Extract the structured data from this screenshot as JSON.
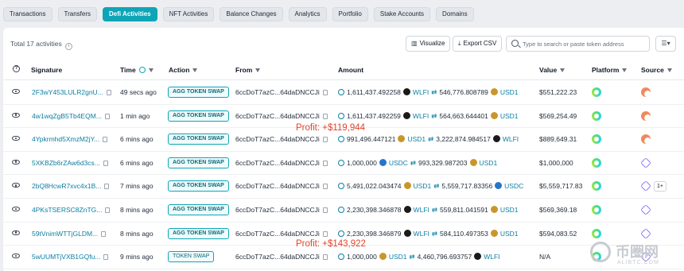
{
  "tabs": [
    {
      "label": "Transactions"
    },
    {
      "label": "Transfers"
    },
    {
      "label": "Defi Activities"
    },
    {
      "label": "NFT Activities"
    },
    {
      "label": "Balance Changes"
    },
    {
      "label": "Analytics"
    },
    {
      "label": "Portfolio"
    },
    {
      "label": "Stake Accounts"
    },
    {
      "label": "Domains"
    }
  ],
  "toolbar": {
    "total_label": "Total 17 activities",
    "visualize_label": "Visualize",
    "export_label": "Export CSV",
    "search_placeholder": "Type to search or paste token address"
  },
  "columns": {
    "signature": "Signature",
    "time": "Time",
    "action": "Action",
    "from": "From",
    "amount": "Amount",
    "value": "Value",
    "platform": "Platform",
    "source": "Source"
  },
  "rows": [
    {
      "signature": "2F3wY453LULR2gnU...",
      "time": "49 secs ago",
      "action": "AGG TOKEN SWAP",
      "from": "6ccDoT7azC...64daDNCCJi",
      "amt_in": "1,611,437.492258",
      "tok_in": "WLFI",
      "amt_out": "546,776.808789",
      "tok_out": "USD1",
      "value": "$551,222.23",
      "source": "orange"
    },
    {
      "signature": "4w1wqZgB5Tb4EQM...",
      "time": "1 min ago",
      "action": "AGG TOKEN SWAP",
      "from": "6ccDoT7azC...64daDNCCJi",
      "amt_in": "1,611,437.492259",
      "tok_in": "WLFI",
      "amt_out": "564,663.644401",
      "tok_out": "USD1",
      "value": "$569,254.49",
      "source": "orange"
    },
    {
      "signature": "4Ypkrmhd5XmzM2jY...",
      "time": "6 mins ago",
      "action": "AGG TOKEN SWAP",
      "from": "6ccDoT7azC...64daDNCCJi",
      "amt_in": "991,496.447121",
      "tok_in": "USD1",
      "amt_out": "3,222,874.984517",
      "tok_out": "WLFI",
      "value": "$889,649.31",
      "source": "orange"
    },
    {
      "signature": "5XKBZb6rZAw6d3cs...",
      "time": "6 mins ago",
      "action": "AGG TOKEN SWAP",
      "from": "6ccDoT7azC...64daDNCCJi",
      "amt_in": "1,000,000",
      "tok_in": "USDC",
      "amt_out": "993,329.987203",
      "tok_out": "USD1",
      "value": "$1,000,000",
      "source": "hex"
    },
    {
      "signature": "2bQ8HcwR7xvc4x1B...",
      "time": "7 mins ago",
      "action": "AGG TOKEN SWAP",
      "from": "6ccDoT7azC...64daDNCCJi",
      "amt_in": "5,491,022.043474",
      "tok_in": "USD1",
      "amt_out": "5,559,717.83356",
      "tok_out": "USDC",
      "value": "$5,559,717.83",
      "source": "hex",
      "more": "1+"
    },
    {
      "signature": "4PKsTSERSC8ZnTG...",
      "time": "8 mins ago",
      "action": "AGG TOKEN SWAP",
      "from": "6ccDoT7azC...64daDNCCJi",
      "amt_in": "2,230,398.346878",
      "tok_in": "WLFI",
      "amt_out": "559,811.041591",
      "tok_out": "USD1",
      "value": "$569,369.18",
      "source": "hex"
    },
    {
      "signature": "59tVnimWTTjGLDM...",
      "time": "8 mins ago",
      "action": "AGG TOKEN SWAP",
      "from": "6ccDoT7azC...64daDNCCJi",
      "amt_in": "2,230,398.346879",
      "tok_in": "WLFI",
      "amt_out": "584,110.497353",
      "tok_out": "USD1",
      "value": "$594,083.52",
      "source": "hex"
    },
    {
      "signature": "5wUUMTjVXB1GQfu...",
      "time": "9 mins ago",
      "action": "TOKEN SWAP",
      "from": "6ccDoT7azC...64daDNCCJi",
      "amt_in": "1,000,000",
      "tok_in": "USD1",
      "amt_out": "4,460,796.693757",
      "tok_out": "WLFI",
      "value": "N/A",
      "source": "hex"
    }
  ],
  "annotations": {
    "profit_1": "Profit: +$119,944",
    "profit_2": "Profit: +$143,922"
  },
  "watermark": {
    "text": "币圈网",
    "sub": "ALIBTC.COM"
  }
}
